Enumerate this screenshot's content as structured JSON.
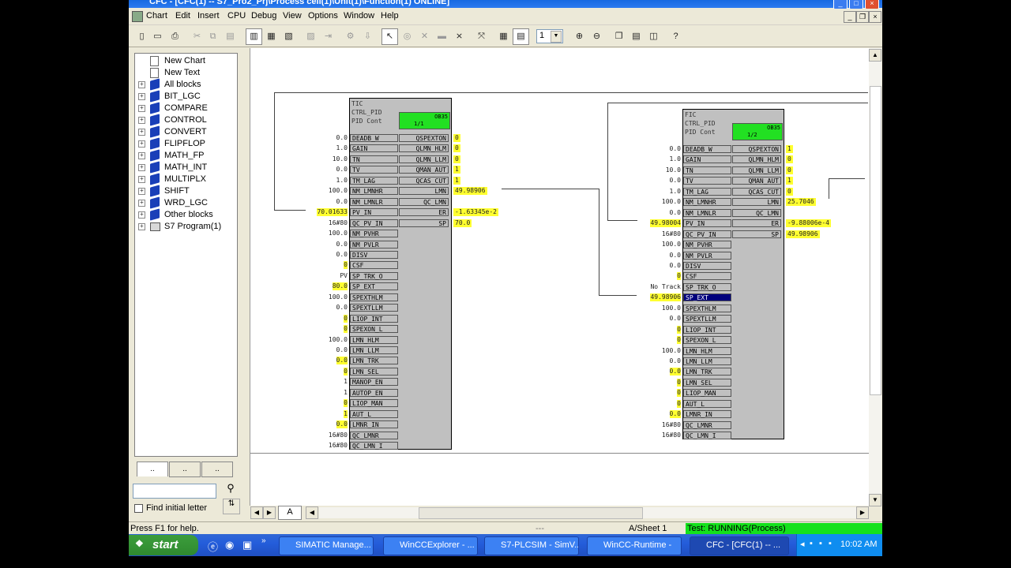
{
  "window": {
    "title": "CFC - [CFC(1) -- S7_Pro2_Prj\\Process cell(1)\\Unit(1)\\Function(1) ONLINE]"
  },
  "menu": [
    "Chart",
    "Edit",
    "Insert",
    "CPU",
    "Debug",
    "View",
    "Options",
    "Window",
    "Help"
  ],
  "toolbar": {
    "page_number": "1"
  },
  "tree": {
    "items": [
      {
        "label": "New Chart",
        "type": "page",
        "expand": false
      },
      {
        "label": "New Text",
        "type": "page",
        "expand": false
      },
      {
        "label": "All blocks",
        "type": "book",
        "expand": true
      },
      {
        "label": "BIT_LGC",
        "type": "book",
        "expand": true
      },
      {
        "label": "COMPARE",
        "type": "book",
        "expand": true
      },
      {
        "label": "CONTROL",
        "type": "book",
        "expand": true
      },
      {
        "label": "CONVERT",
        "type": "book",
        "expand": true
      },
      {
        "label": "FLIPFLOP",
        "type": "book",
        "expand": true
      },
      {
        "label": "MATH_FP",
        "type": "book",
        "expand": true
      },
      {
        "label": "MATH_INT",
        "type": "book",
        "expand": true
      },
      {
        "label": "MULTIPLX",
        "type": "book",
        "expand": true
      },
      {
        "label": "SHIFT",
        "type": "book",
        "expand": true
      },
      {
        "label": "WRD_LGC",
        "type": "book",
        "expand": true
      },
      {
        "label": "Other blocks",
        "type": "book",
        "expand": true
      },
      {
        "label": "S7 Program(1)",
        "type": "prog",
        "expand": true
      }
    ],
    "tabs": [
      "..",
      "..",
      ".."
    ],
    "find_label": "Find initial letter"
  },
  "sheet_tab": "A",
  "blocks": [
    {
      "head": [
        "TIC",
        "CTRL_PID",
        "PID Cont"
      ],
      "ob": "OB35",
      "seq": "1/1",
      "inputs": [
        {
          "name": "DEADB_W",
          "value": "0.0",
          "hl": false
        },
        {
          "name": "GAIN",
          "value": "1.0",
          "hl": false
        },
        {
          "name": "TN",
          "value": "10.0",
          "hl": false
        },
        {
          "name": "TV",
          "value": "0.0",
          "hl": false
        },
        {
          "name": "TM_LAG",
          "value": "1.0",
          "hl": false
        },
        {
          "name": "NM_LMNHR",
          "value": "100.0",
          "hl": false
        },
        {
          "name": "NM_LMNLR",
          "value": "0.0",
          "hl": false
        },
        {
          "name": "PV_IN",
          "value": "70.01633",
          "hl": true
        },
        {
          "name": "QC_PV_IN",
          "value": "16#80",
          "hl": false
        },
        {
          "name": "NM_PVHR",
          "value": "100.0",
          "hl": false
        },
        {
          "name": "NM_PVLR",
          "value": "0.0",
          "hl": false
        },
        {
          "name": "DISV",
          "value": "0.0",
          "hl": false
        },
        {
          "name": "CSF",
          "value": "0",
          "hl": true
        },
        {
          "name": "SP_TRK_O",
          "value": "PV",
          "hl": false
        },
        {
          "name": "SP_EXT",
          "value": "80.0",
          "hl": true
        },
        {
          "name": "SPEXTHLM",
          "value": "100.0",
          "hl": false
        },
        {
          "name": "SPEXTLLM",
          "value": "0.0",
          "hl": false
        },
        {
          "name": "LIOP_INT",
          "value": "0",
          "hl": true
        },
        {
          "name": "SPEXON_L",
          "value": "0",
          "hl": true
        },
        {
          "name": "LMN_HLM",
          "value": "100.0",
          "hl": false
        },
        {
          "name": "LMN_LLM",
          "value": "0.0",
          "hl": false
        },
        {
          "name": "LMN_TRK",
          "value": "0.0",
          "hl": true
        },
        {
          "name": "LMN_SEL",
          "value": "0",
          "hl": true
        },
        {
          "name": "MANOP_EN",
          "value": "1",
          "hl": false
        },
        {
          "name": "AUTOP_EN",
          "value": "1",
          "hl": false
        },
        {
          "name": "LIOP_MAN",
          "value": "0",
          "hl": true
        },
        {
          "name": "AUT_L",
          "value": "1",
          "hl": true
        },
        {
          "name": "LMNR_IN",
          "value": "0.0",
          "hl": true
        },
        {
          "name": "QC_LMNR",
          "value": "16#80",
          "hl": false
        },
        {
          "name": "QC_LMN_I",
          "value": "16#80",
          "hl": false
        }
      ],
      "outputs": [
        {
          "name": "QSPEXTON",
          "value": "0",
          "hl": true
        },
        {
          "name": "QLMN_HLM",
          "value": "0",
          "hl": true
        },
        {
          "name": "QLMN_LLM",
          "value": "0",
          "hl": true
        },
        {
          "name": "QMAN_AUT",
          "value": "1",
          "hl": true
        },
        {
          "name": "QCAS_CUT",
          "value": "1",
          "hl": true
        },
        {
          "name": "LMN",
          "value": "49.98906",
          "hl": true
        },
        {
          "name": "QC_LMN",
          "value": "",
          "hl": false
        },
        {
          "name": "ER",
          "value": "-1.63345e-2",
          "hl": true
        },
        {
          "name": "SP",
          "value": "70.0",
          "hl": true
        }
      ]
    },
    {
      "head": [
        "FIC",
        "CTRL_PID",
        "PID Cont"
      ],
      "ob": "OB35",
      "seq": "1/2",
      "inputs": [
        {
          "name": "DEADB_W",
          "value": "0.0",
          "hl": false
        },
        {
          "name": "GAIN",
          "value": "1.0",
          "hl": false
        },
        {
          "name": "TN",
          "value": "10.0",
          "hl": false
        },
        {
          "name": "TV",
          "value": "0.0",
          "hl": false
        },
        {
          "name": "TM_LAG",
          "value": "1.0",
          "hl": false
        },
        {
          "name": "NM_LMNHR",
          "value": "100.0",
          "hl": false
        },
        {
          "name": "NM_LMNLR",
          "value": "0.0",
          "hl": false
        },
        {
          "name": "PV_IN",
          "value": "49.98004",
          "hl": true
        },
        {
          "name": "QC_PV_IN",
          "value": "16#80",
          "hl": false
        },
        {
          "name": "NM_PVHR",
          "value": "100.0",
          "hl": false
        },
        {
          "name": "NM_PVLR",
          "value": "0.0",
          "hl": false
        },
        {
          "name": "DISV",
          "value": "0.0",
          "hl": false
        },
        {
          "name": "CSF",
          "value": "0",
          "hl": true
        },
        {
          "name": "SP_TRK_O",
          "value": "No Track",
          "hl": false
        },
        {
          "name": "SP_EXT",
          "value": "49.98906",
          "hl": true,
          "sel": true
        },
        {
          "name": "SPEXTHLM",
          "value": "100.0",
          "hl": false
        },
        {
          "name": "SPEXTLLM",
          "value": "0.0",
          "hl": false
        },
        {
          "name": "LIOP_INT",
          "value": "0",
          "hl": true
        },
        {
          "name": "SPEXON_L",
          "value": "0",
          "hl": true
        },
        {
          "name": "LMN_HLM",
          "value": "100.0",
          "hl": false
        },
        {
          "name": "LMN_LLM",
          "value": "0.0",
          "hl": false
        },
        {
          "name": "LMN_TRK",
          "value": "0.0",
          "hl": true
        },
        {
          "name": "LMN_SEL",
          "value": "0",
          "hl": true
        },
        {
          "name": "LIOP_MAN",
          "value": "0",
          "hl": true
        },
        {
          "name": "AUT_L",
          "value": "0",
          "hl": true
        },
        {
          "name": "LMNR_IN",
          "value": "0.0",
          "hl": true
        },
        {
          "name": "QC_LMNR",
          "value": "16#80",
          "hl": false
        },
        {
          "name": "QC_LMN_I",
          "value": "16#80",
          "hl": false
        }
      ],
      "outputs": [
        {
          "name": "QSPEXTON",
          "value": "1",
          "hl": true
        },
        {
          "name": "QLMN_HLM",
          "value": "0",
          "hl": true
        },
        {
          "name": "QLMN_LLM",
          "value": "0",
          "hl": true
        },
        {
          "name": "QMAN_AUT",
          "value": "1",
          "hl": true
        },
        {
          "name": "QCAS_CUT",
          "value": "0",
          "hl": true
        },
        {
          "name": "LMN",
          "value": "25.7046",
          "hl": true
        },
        {
          "name": "QC_LMN",
          "value": "",
          "hl": false
        },
        {
          "name": "ER",
          "value": "-9.88006e-4",
          "hl": true
        },
        {
          "name": "SP",
          "value": "49.98906",
          "hl": true
        }
      ]
    }
  ],
  "status": {
    "help": "Press F1 for help.",
    "dashes": "---",
    "sheet": "A/Sheet 1",
    "mode": "Test: RUNNING(Process)"
  },
  "taskbar": {
    "start": "start",
    "buttons": [
      "SIMATIC Manage...",
      "WinCCExplorer - ...",
      "S7-PLCSIM - SimV...",
      "WinCC-Runtime -",
      "CFC - [CFC(1) -- ..."
    ],
    "clock": "10:02 AM"
  },
  "colors": {
    "highlight": "#ffff30",
    "status_green": "#14e11c",
    "ob_green": "#22e022"
  }
}
